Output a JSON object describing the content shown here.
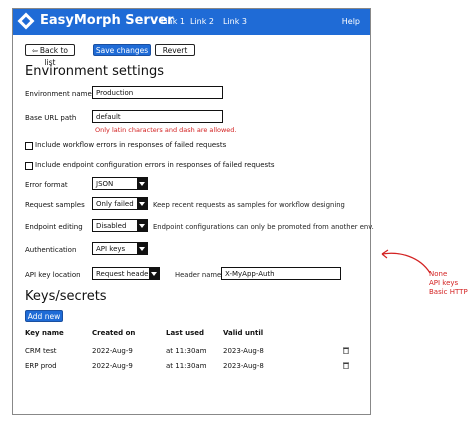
{
  "header": {
    "app_title": "EasyMorph Server",
    "links": [
      "Link 1",
      "Link 2",
      "Link 3"
    ],
    "help": "Help",
    "brand_color": "#1f6bd6"
  },
  "toolbar": {
    "back_label": "Back to list",
    "save_label": "Save changes",
    "revert_label": "Revert"
  },
  "environment": {
    "heading": "Environment settings",
    "name_label": "Environment name",
    "name_value": "Production",
    "base_url_label": "Base URL path",
    "base_url_value": "default",
    "base_url_error": "Only latin characters and dash are allowed.",
    "workflow_errors_label": "Include workflow errors in responses of failed requests",
    "endpoint_errors_label": "Include endpoint configuration errors in responses of failed requests",
    "error_format_label": "Error format",
    "error_format_value": "JSON",
    "request_samples_label": "Request samples",
    "request_samples_value": "Only failed",
    "request_samples_hint": "Keep recent requests as samples for workflow designing",
    "endpoint_editing_label": "Endpoint editing",
    "endpoint_editing_value": "Disabled",
    "endpoint_editing_hint": "Endpoint configurations can only be promoted from another env.",
    "authentication_label": "Authentication",
    "authentication_value": "API keys",
    "api_key_location_label": "API key location",
    "api_key_location_value": "Request header",
    "header_name_label": "Header name",
    "header_name_value": "X-MyApp-Auth"
  },
  "keys": {
    "heading": "Keys/secrets",
    "add_label": "Add new",
    "columns": [
      "Key name",
      "Created on",
      "Last used",
      "Valid until"
    ],
    "rows": [
      {
        "name": "CRM test",
        "created": "2022-Aug-9",
        "last_used": "at 11:30am",
        "valid_until": "2023-Aug-8"
      },
      {
        "name": "ERP prod",
        "created": "2022-Aug-9",
        "last_used": "at 11:30am",
        "valid_until": "2023-Aug-8"
      }
    ]
  },
  "annotation": {
    "lines": [
      "None",
      "API keys",
      "Basic HTTP"
    ],
    "color": "#d32222"
  }
}
